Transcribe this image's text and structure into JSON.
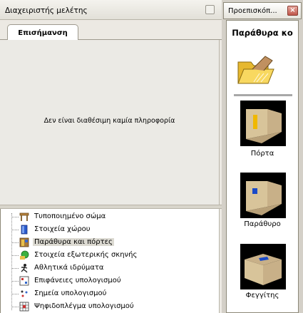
{
  "left_panel": {
    "title": "Διαχειριστής μελέτης",
    "tab": "Επισήμανση",
    "message": "Δεν είναι διαθέσιμη καμία πληροφορία",
    "tree": [
      {
        "label": "Τυποποιημένο σώμα",
        "icon": "standard-body-icon",
        "selected": false
      },
      {
        "label": "Στοιχεία χώρου",
        "icon": "room-elements-icon",
        "selected": false
      },
      {
        "label": "Παράθυρα και πόρτες",
        "icon": "windows-doors-icon",
        "selected": true
      },
      {
        "label": "Στοιχεία εξωτερικής σκηνής",
        "icon": "exterior-scene-icon",
        "selected": false
      },
      {
        "label": "Αθλητικά ιδρύματα",
        "icon": "sports-facilities-icon",
        "selected": false
      },
      {
        "label": "Επιφάνειες υπολογισμού",
        "icon": "calc-surfaces-icon",
        "selected": false
      },
      {
        "label": "Σημεία υπολογισμού",
        "icon": "calc-points-icon",
        "selected": false
      },
      {
        "label": "Ψηφιδοπλέγμα υπολογισμού",
        "icon": "calc-grid-icon",
        "selected": false
      }
    ]
  },
  "right_panel": {
    "title": "Προεπισκόπ...",
    "close": "×",
    "category": "Παράθυρα κο",
    "items": [
      {
        "label": "Πόρτα",
        "icon": "door-preview-icon"
      },
      {
        "label": "Παράθυρο",
        "icon": "window-preview-icon"
      },
      {
        "label": "Φεγγίτης",
        "icon": "skylight-preview-icon"
      }
    ]
  }
}
